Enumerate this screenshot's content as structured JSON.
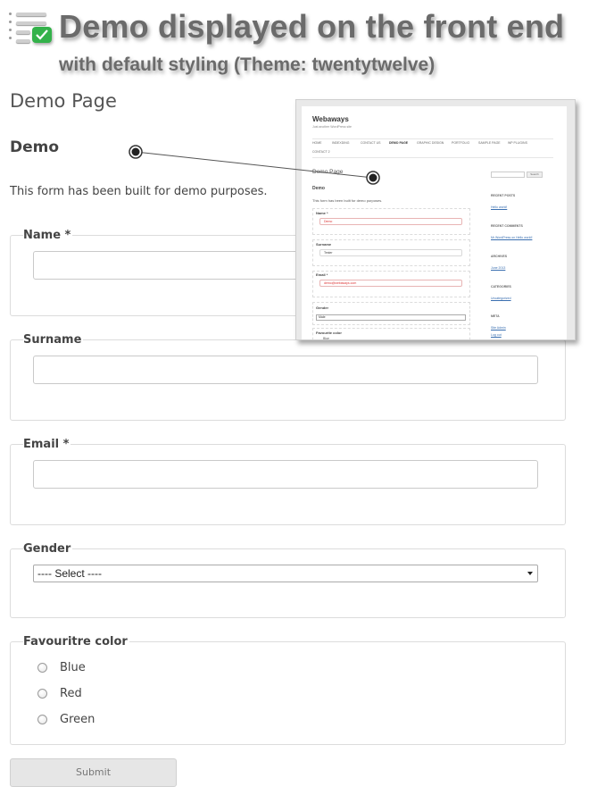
{
  "banner": {
    "title": "Demo displayed on the front end",
    "subtitle": "with default styling (Theme: twentytwelve)",
    "check_color": "#33b24a"
  },
  "page": {
    "title": "Demo Page",
    "form_title": "Demo",
    "description": "This form has been built for demo purposes."
  },
  "form": {
    "name_label": "Name *",
    "name_value": "",
    "surname_label": "Surname",
    "surname_value": "",
    "email_label": "Email *",
    "email_value": "",
    "gender_label": "Gender",
    "gender_selected": "---- Select ----",
    "color_label": "Favouritre color",
    "color_options": [
      "Blue",
      "Red",
      "Green"
    ],
    "submit_label": "Submit"
  },
  "inset": {
    "site_title": "Webaways",
    "tagline": "Just another WordPress site",
    "nav": [
      "HOME",
      "INDEXDING",
      "CONTACT US",
      "DEMO PAGE",
      "GRAPHIC DESIGN",
      "PORTFOLIO",
      "SAMPLE PAGE",
      "WP PLUGINS",
      "CONTACT 2"
    ],
    "page_title": "Demo Page",
    "form_title": "Demo",
    "description": "This form has been built for demo purposes.",
    "name_label": "Name *",
    "name_value": "Demo",
    "surname_label": "Surname",
    "surname_value": "Tester",
    "email_label": "Email *",
    "email_value": "demo@webaways.com",
    "gender_label": "Gender",
    "gender_value": "Male",
    "color_label": "Favourite color",
    "color_first": "Blue",
    "search_button": "Search",
    "sidebar": [
      {
        "text": "RECENT POSTS",
        "kind": "heading"
      },
      {
        "text": "Hello world!",
        "kind": "link"
      },
      {
        "text": "RECENT COMMENTS",
        "kind": "heading"
      },
      {
        "text": "Mr WordPress on Hello world!",
        "kind": "link"
      },
      {
        "text": "ARCHIVES",
        "kind": "heading"
      },
      {
        "text": "June 2013",
        "kind": "link"
      },
      {
        "text": "CATEGORIES",
        "kind": "heading"
      },
      {
        "text": "Uncategorized",
        "kind": "link"
      },
      {
        "text": "META",
        "kind": "heading"
      },
      {
        "text": "Site Admin",
        "kind": "link"
      },
      {
        "text": "Log out",
        "kind": "link"
      }
    ]
  }
}
